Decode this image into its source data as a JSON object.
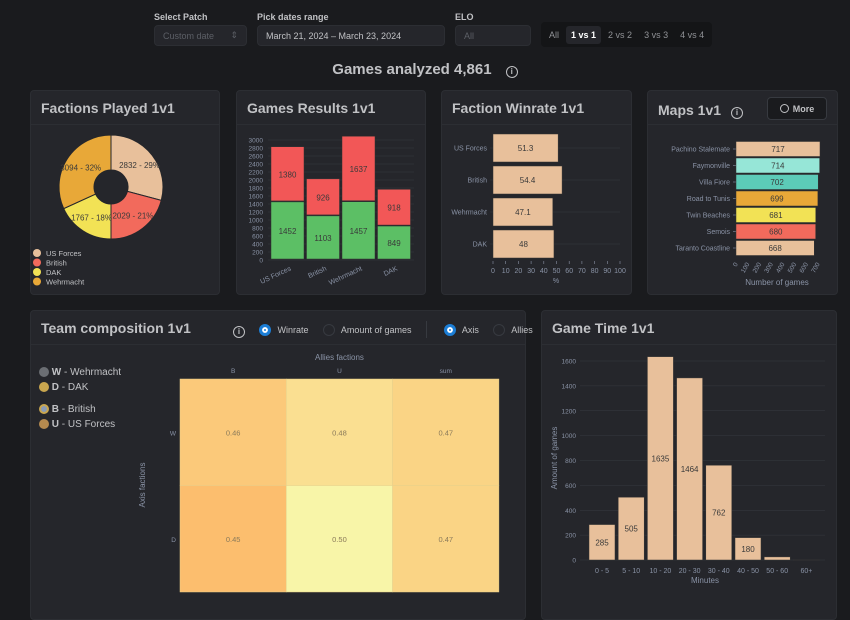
{
  "filters": {
    "patch_label": "Select Patch",
    "patch_value": "Custom date",
    "dates_label": "Pick dates range",
    "dates_value": "March 21, 2024 – March 23, 2024",
    "elo_label": "ELO",
    "elo_placeholder": "All",
    "modes": [
      "All",
      "1 vs 1",
      "2 vs 2",
      "3 vs 3",
      "4 vs 4"
    ],
    "active_mode": "1 vs 1"
  },
  "summary": {
    "title": "Games analyzed 4,861"
  },
  "cards": {
    "factions": "Factions Played 1v1",
    "results": "Games Results 1v1",
    "winrate": "Faction Winrate 1v1",
    "maps": "Maps 1v1",
    "maps_more": "More",
    "team": "Team composition 1v1",
    "gametime": "Game Time 1v1"
  },
  "team_controls": {
    "metric_options": [
      "Winrate",
      "Amount of games"
    ],
    "metric_selected": "Winrate",
    "side_options": [
      "Axis",
      "Allies"
    ],
    "side_selected": "Axis"
  },
  "team_legend": [
    {
      "code": "W",
      "name": "- Wehrmacht"
    },
    {
      "code": "D",
      "name": "- DAK"
    },
    {
      "code": "B",
      "name": "- British"
    },
    {
      "code": "U",
      "name": "- US Forces"
    }
  ],
  "chart_data": [
    {
      "type": "pie",
      "title": "Factions Played 1v1",
      "donut": true,
      "labels": [
        "US Forces",
        "British",
        "DAK",
        "Wehrmacht"
      ],
      "values": [
        2832,
        2029,
        1767,
        3094
      ],
      "percent": [
        29,
        21,
        18,
        32
      ],
      "colors": [
        "#e8c09b",
        "#f26a5c",
        "#f2e255",
        "#e8a838"
      ],
      "legend": "bottom-left"
    },
    {
      "type": "bar",
      "stacked": true,
      "title": "Games Results 1v1",
      "categories": [
        "US Forces",
        "British",
        "Wehrmacht",
        "DAK"
      ],
      "series": [
        {
          "values": [
            1452,
            1103,
            1457,
            849
          ],
          "color": "#5cbf65"
        },
        {
          "values": [
            1380,
            926,
            1637,
            918
          ],
          "color": "#f25757"
        }
      ],
      "ylim": [
        0,
        3000
      ],
      "yticks": [
        0,
        200,
        400,
        600,
        800,
        1000,
        1200,
        1400,
        1600,
        1800,
        2000,
        2200,
        2400,
        2600,
        2800,
        3000
      ]
    },
    {
      "type": "bar",
      "orientation": "horizontal",
      "title": "Faction Winrate 1v1",
      "categories": [
        "US Forces",
        "British",
        "Wehrmacht",
        "DAK"
      ],
      "values": [
        51.3,
        54.4,
        47.1,
        48
      ],
      "xlabel": "%",
      "xlim": [
        0,
        100
      ],
      "xticks": [
        0,
        10,
        20,
        30,
        40,
        50,
        60,
        70,
        80,
        90,
        100
      ],
      "color": "#e8c09b"
    },
    {
      "type": "bar",
      "orientation": "horizontal",
      "title": "Maps 1v1",
      "categories": [
        "Pachino Stalemate",
        "Faymonville",
        "Villa Fiore",
        "Road to Tunis",
        "Twin Beaches",
        "Semois",
        "Taranto Coastline"
      ],
      "values": [
        717,
        714,
        702,
        699,
        681,
        680,
        668
      ],
      "colors": [
        "#e8c09b",
        "#96e6d7",
        "#5ccbb8",
        "#e8a838",
        "#f2e255",
        "#f26a5c",
        "#e8c09b"
      ],
      "xlabel": "Number of games",
      "xticks": [
        0,
        100,
        200,
        300,
        400,
        500,
        600,
        700
      ]
    },
    {
      "type": "heatmap",
      "title": "Team composition 1v1",
      "xlabel": "Allies factions",
      "ylabel": "Axis factions",
      "x": [
        "B",
        "U",
        "sum"
      ],
      "y": [
        "W",
        "D"
      ],
      "values": [
        [
          0.46,
          0.48,
          0.47
        ],
        [
          0.45,
          0.5,
          0.47
        ]
      ],
      "labels": [
        [
          "0.46",
          "0.48",
          "0.47"
        ],
        [
          "0.45",
          "0.50",
          "0.47"
        ]
      ]
    },
    {
      "type": "bar",
      "title": "Game Time 1v1",
      "categories": [
        "0 - 5",
        "5 - 10",
        "10 - 20",
        "20 - 30",
        "30 - 40",
        "40 - 50",
        "50 - 60",
        "60+"
      ],
      "values": [
        285,
        505,
        1635,
        1464,
        762,
        180,
        25,
        2
      ],
      "labels": [
        "285",
        "505",
        "1635",
        "1464",
        "762",
        "180",
        "",
        ""
      ],
      "xlabel": "Minutes",
      "ylabel": "Amount of games",
      "ylim": [
        0,
        1650
      ],
      "yticks": [
        0,
        200,
        400,
        600,
        800,
        1000,
        1200,
        1400,
        1600
      ],
      "color": "#e8c09b"
    }
  ]
}
